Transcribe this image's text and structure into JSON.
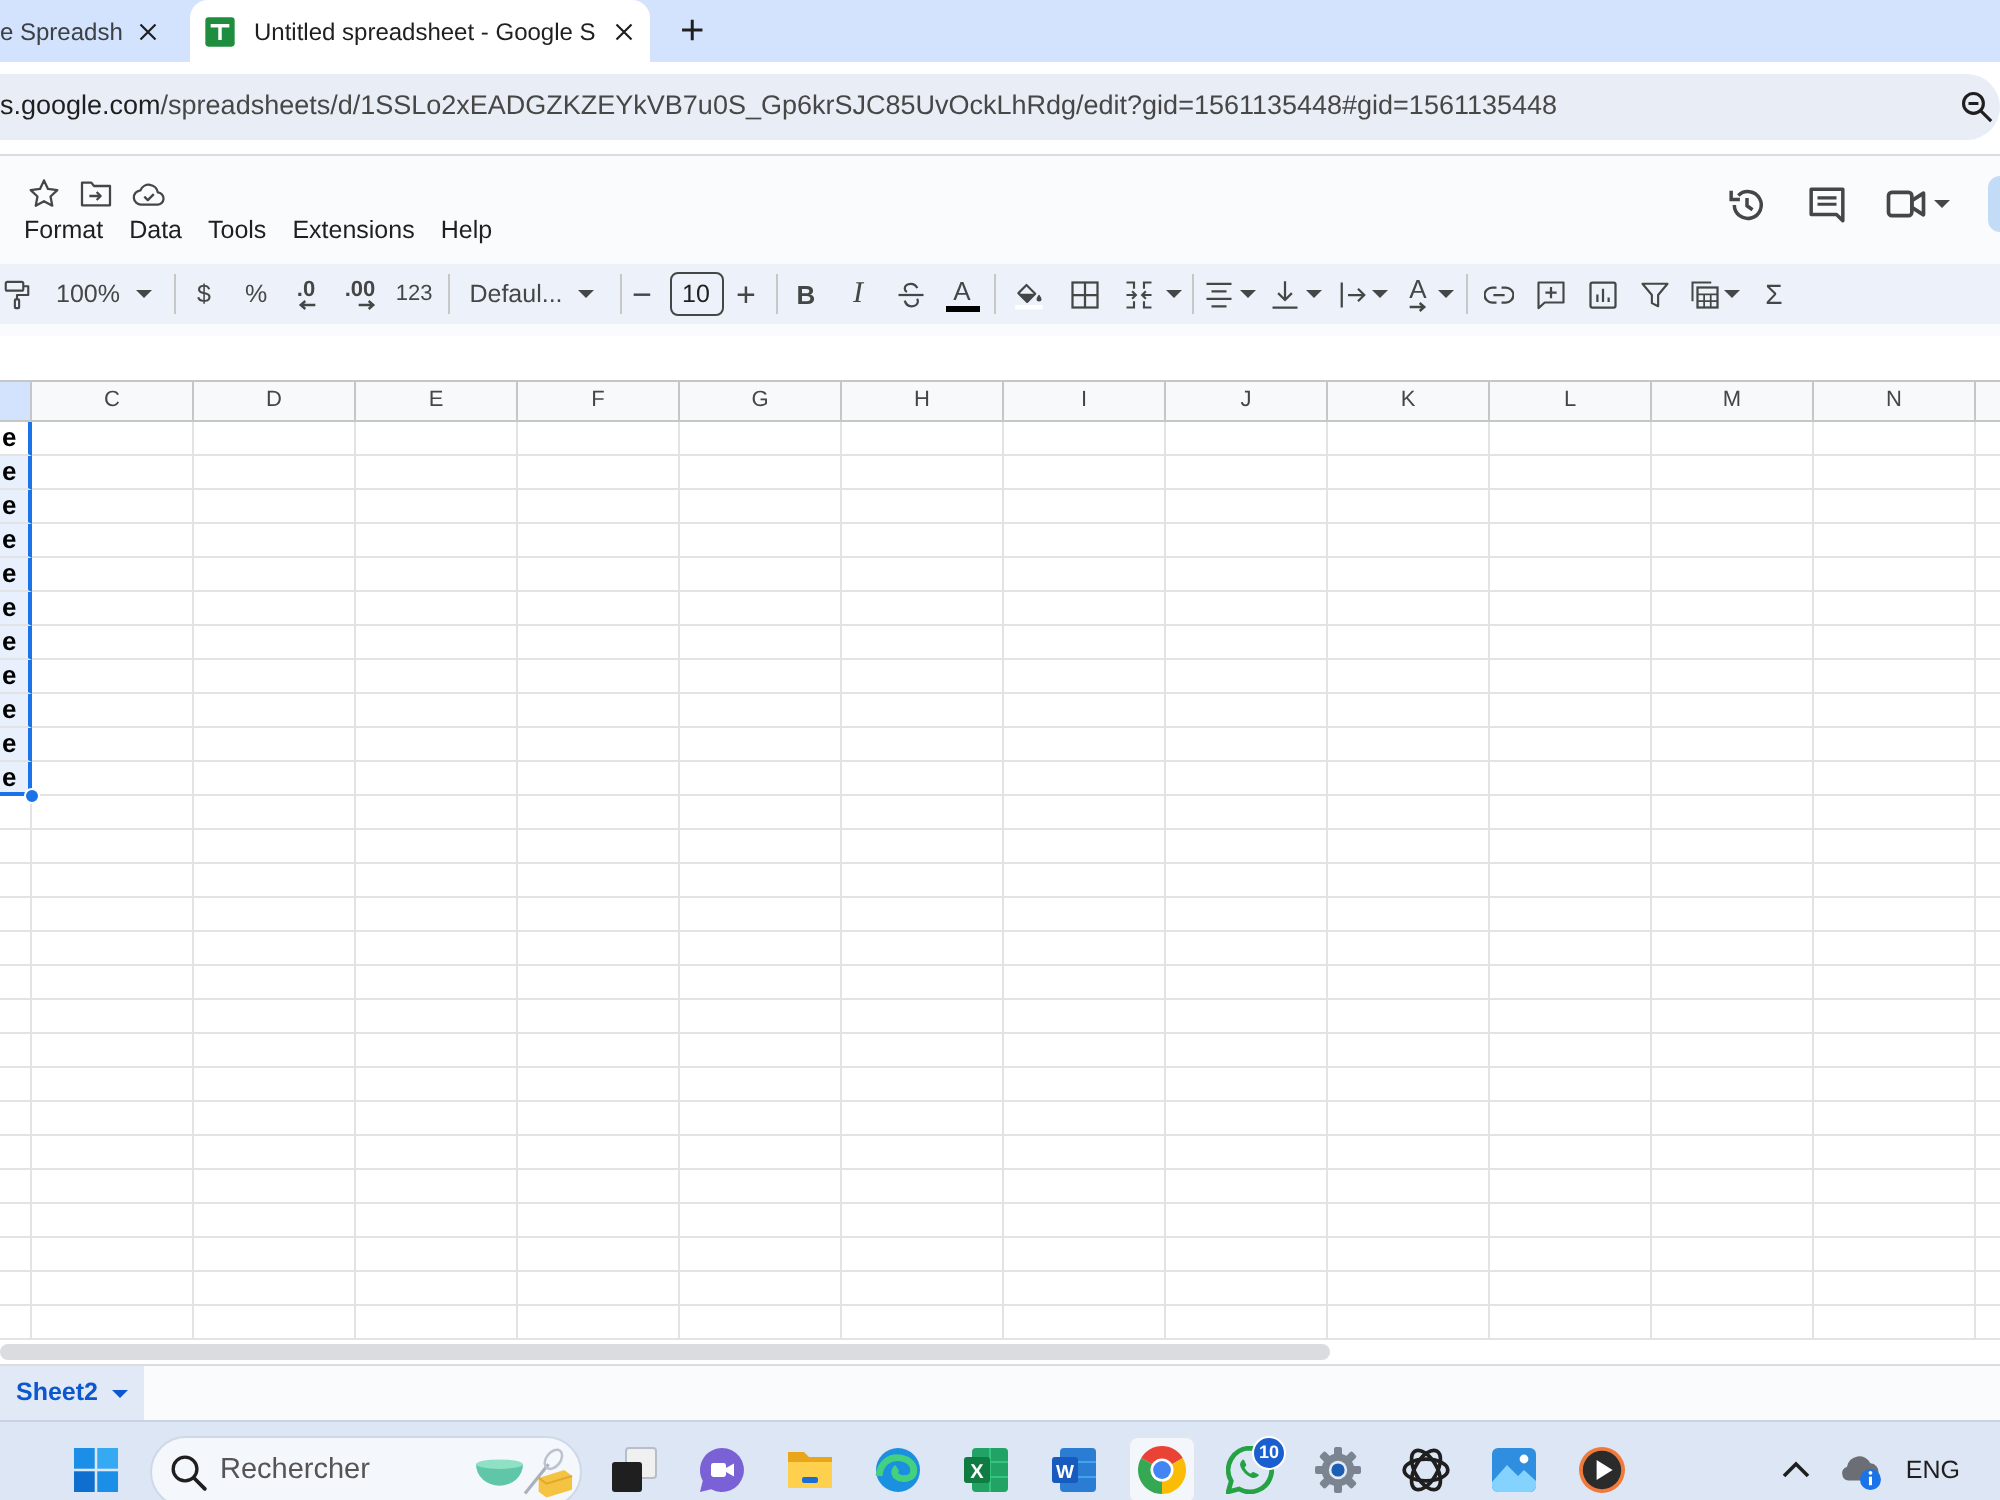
{
  "browser": {
    "tabs": [
      {
        "title": "e Spreadsh",
        "selected": false
      },
      {
        "title": "Untitled spreadsheet - Google S",
        "selected": true
      }
    ],
    "new_tab": "+",
    "address": {
      "host": "s.google.com",
      "path": "/spreadsheets/d/1SSLo2xEADGZKZEYkVB7u0S_Gp6krSJC85UvOckLhRdg/edit?gid=1561135448#gid=1561135448"
    }
  },
  "menu": [
    "Format",
    "Data",
    "Tools",
    "Extensions",
    "Help"
  ],
  "toolbar": {
    "zoom": "100%",
    "currency": "$",
    "percent": "%",
    "decrease_decimal": ".0",
    "increase_decimal": ".00",
    "number_format": "123",
    "font": "Defaul...",
    "size_down": "−",
    "font_size": "10",
    "size_up": "+",
    "bold": "B",
    "italic": "I",
    "text_color": "A",
    "text_rotation": "A",
    "functions": "Σ"
  },
  "grid": {
    "columns": [
      "C",
      "D",
      "E",
      "F",
      "G",
      "H",
      "I",
      "J",
      "K",
      "L",
      "M",
      "N"
    ],
    "cut_column": {
      "selected": true,
      "cells": [
        "e",
        "e",
        "e",
        "e",
        "e",
        "e",
        "e",
        "e",
        "e",
        "e",
        "e"
      ]
    }
  },
  "sheet_tabs": [
    {
      "label": "Sheet2",
      "selected": true
    }
  ],
  "taskbar": {
    "search": {
      "placeholder": "Rechercher"
    },
    "apps": [
      {
        "kind": "task-view",
        "selected": false
      },
      {
        "kind": "video-chat",
        "selected": false
      },
      {
        "kind": "folder",
        "selected": false
      },
      {
        "kind": "swirl-browser",
        "selected": false
      },
      {
        "kind": "spreadsheet",
        "label": "X",
        "selected": false
      },
      {
        "kind": "document",
        "label": "W",
        "selected": false
      },
      {
        "kind": "browser",
        "selected": true
      },
      {
        "kind": "chat",
        "badge": "10",
        "selected": false
      },
      {
        "kind": "gear",
        "selected": false
      },
      {
        "kind": "knot",
        "selected": false
      },
      {
        "kind": "photos",
        "selected": false
      },
      {
        "kind": "player",
        "selected": false
      }
    ],
    "language": "ENG"
  }
}
